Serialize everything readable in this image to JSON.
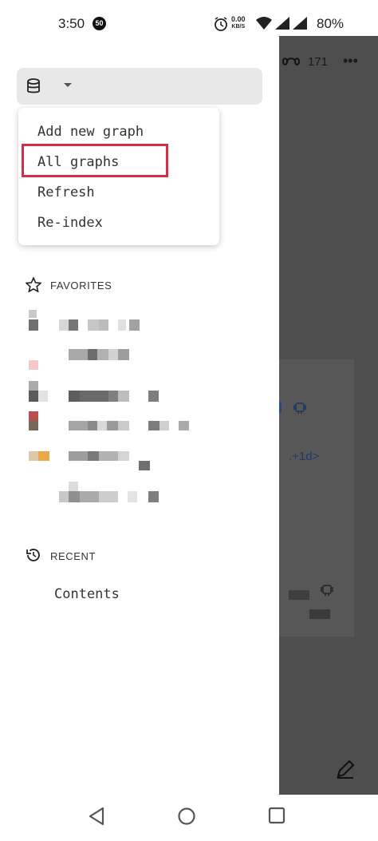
{
  "status_bar": {
    "time": "3:50",
    "notification_badge": "50",
    "speed_value": "0.00",
    "speed_unit": "KB/S",
    "battery": "80%"
  },
  "background_page": {
    "link_count": "171",
    "more_label": "•••",
    "date_text": ".+1d>"
  },
  "graph_menu": {
    "items": [
      {
        "label": "Add new graph"
      },
      {
        "label": "All graphs"
      },
      {
        "label": "Refresh"
      },
      {
        "label": "Re-index"
      }
    ],
    "highlighted_index": 1
  },
  "favorites": {
    "title": "FAVORITES",
    "items_blurred": 6
  },
  "recent": {
    "title": "RECENT",
    "items": [
      {
        "label": "Contents"
      }
    ]
  },
  "colors": {
    "highlight": "#d32f48",
    "overlay": "#4e4e4e",
    "selector_bg": "#e8e8e8"
  }
}
